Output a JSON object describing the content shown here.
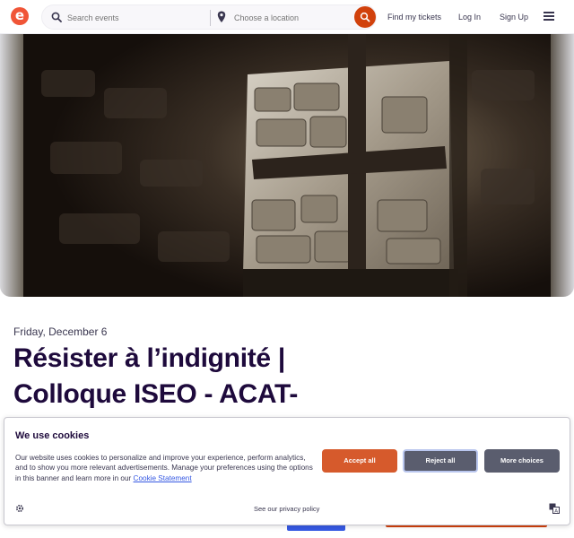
{
  "header": {
    "logo_letter": "e",
    "search_placeholder": "Search events",
    "location_placeholder": "Choose a location",
    "find_tickets": "Find my tickets",
    "login": "Log In",
    "signup": "Sign Up"
  },
  "event": {
    "date": "Friday, December 6",
    "title_line1": "Résister à l’indignité |",
    "title_line2": "Colloque ISEO - ACAT-"
  },
  "cookie": {
    "title": "We use cookies",
    "text": "Our website uses cookies to personalize and improve your experience, perform analytics, and to show you more relevant advertisements. Manage your preferences using the options in this banner and learn more in our ",
    "link": "Cookie Statement",
    "accept": "Accept all",
    "reject": "Reject all",
    "more": "More choices",
    "privacy": "See our privacy policy"
  },
  "colors": {
    "brand": "#f05537",
    "accent": "#d1410c",
    "title": "#1e0a3c"
  }
}
